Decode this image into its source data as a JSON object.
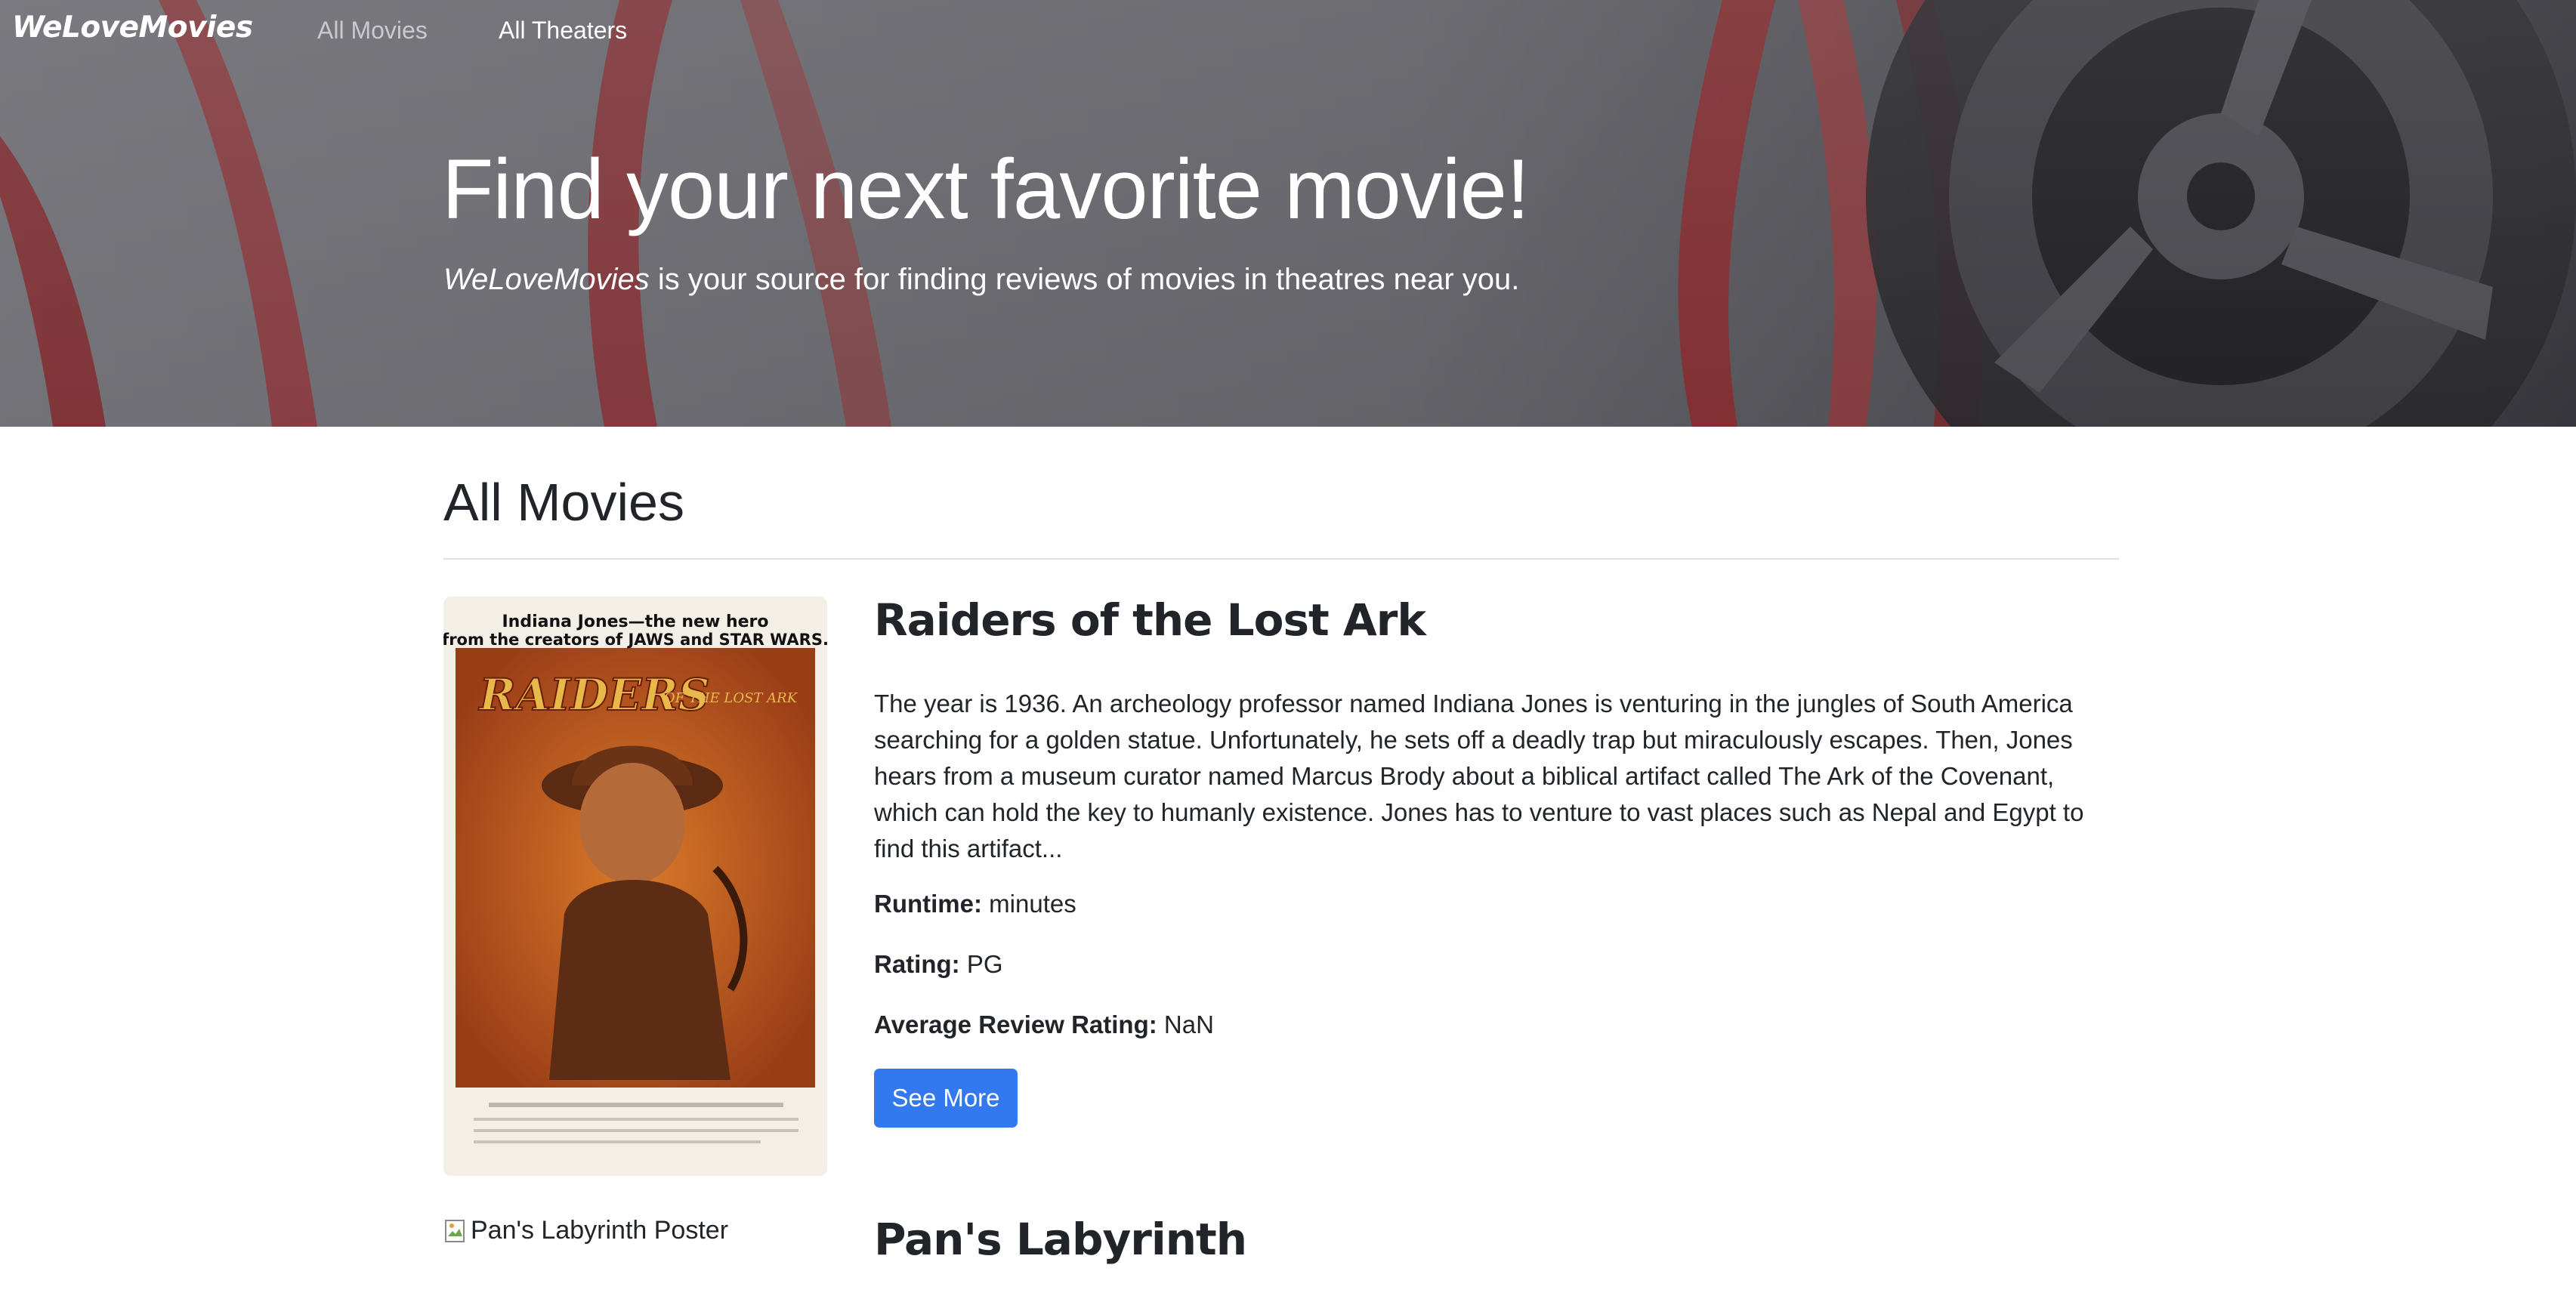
{
  "navbar": {
    "brand": "WeLoveMovies",
    "links": [
      "All Movies",
      "All Theaters"
    ]
  },
  "hero": {
    "title": "Find your next favorite movie!",
    "subtitle_brand": "WeLoveMovies",
    "subtitle_rest": " is your source for finding reviews of movies in theatres near you."
  },
  "main": {
    "section_title": "All Movies",
    "movies": [
      {
        "title": "Raiders of the Lost Ark",
        "description": "The year is 1936. An archeology professor named Indiana Jones is venturing in the jungles of South America searching for a golden statue. Unfortunately, he sets off a deadly trap but miraculously escapes. Then, Jones hears from a museum curator named Marcus Brody about a biblical artifact called The Ark of the Covenant, which can hold the key to humanly existence. Jones has to venture to vast places such as Nepal and Egypt to find this artifact...",
        "runtime_label": "Runtime:",
        "runtime_value": " minutes",
        "rating_label": "Rating:",
        "rating_value": " PG",
        "avg_label": "Average Review Rating:",
        "avg_value": " NaN",
        "button": "See More",
        "poster_lines": [
          "Indiana Jones—the new hero",
          "from the creators of JAWS and STAR WARS.",
          "RAIDERS",
          "OF THE LOST ARK"
        ]
      },
      {
        "title": "Pan's Labyrinth",
        "poster_alt": "Pan's Labyrinth Poster"
      }
    ]
  },
  "colors": {
    "primary_button": "#3279f0",
    "text": "#212529",
    "divider": "#dee2e6"
  }
}
